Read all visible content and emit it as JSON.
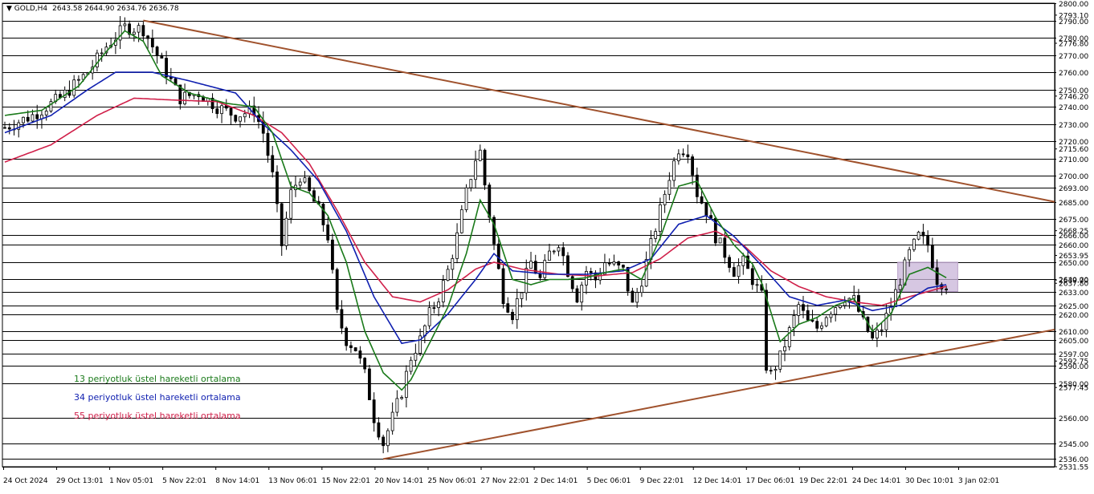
{
  "header": {
    "symbol": "GOLD,H4",
    "ohlc": "2643.58 2644.90 2634.76 2636.78"
  },
  "colors": {
    "ema13": "#1a7a1a",
    "ema34": "#1020b0",
    "ema55": "#d0204a",
    "trendline": "#a0522d",
    "candle": "#000000",
    "grid": "#000000",
    "highlight_box": "#c8b4d8"
  },
  "legend": [
    {
      "label": "13 periyotluk üstel hareketli ortalama",
      "color": "#1a7a1a"
    },
    {
      "label": "34 periyotluk üstel hareketli ortalama",
      "color": "#1020b0"
    },
    {
      "label": "55 periyotluk üstel hareketli ortalama",
      "color": "#d0204a"
    }
  ],
  "chart_data": {
    "type": "candlestick",
    "ylim": [
      2531.55,
      2800.0
    ],
    "y_levels": [
      2800.0,
      2790.0,
      2780.0,
      2770.0,
      2760.0,
      2750.0,
      2740.0,
      2730.0,
      2720.0,
      2710.0,
      2700.0,
      2693.0,
      2685.0,
      2675.0,
      2666.0,
      2660.0,
      2650.0,
      2640.0,
      2633.0,
      2625.0,
      2620.0,
      2610.0,
      2605.0,
      2597.0,
      2590.0,
      2580.0,
      2560.0,
      2545.0,
      2536.0
    ],
    "y_extra_ticks": [
      "2793.10",
      "2776.80",
      "2746.20",
      "2715.60",
      "2668.25",
      "2653.95",
      "2639.70",
      "2637.80",
      "2592.75",
      "2577.45",
      "2531.55"
    ],
    "x_tick_labels": [
      "24 Oct 2024",
      "29 Oct 13:01",
      "1 Nov 05:01",
      "5 Nov 22:01",
      "8 Nov 14:01",
      "13 Nov 06:01",
      "15 Nov 22:01",
      "20 Nov 14:01",
      "25 Nov 06:01",
      "27 Nov 22:01",
      "2 Dec 14:01",
      "5 Dec 06:01",
      "9 Dec 22:01",
      "12 Dec 14:01",
      "17 Dec 06:01",
      "19 Dec 22:01",
      "24 Dec 14:01",
      "30 Dec 10:01",
      "3 Jan 02:01"
    ],
    "price_path": [
      [
        0,
        2728
      ],
      [
        6,
        2735
      ],
      [
        12,
        2745
      ],
      [
        18,
        2760
      ],
      [
        22,
        2775
      ],
      [
        26,
        2786
      ],
      [
        30,
        2785
      ],
      [
        34,
        2765
      ],
      [
        38,
        2745
      ],
      [
        42,
        2748
      ],
      [
        46,
        2740
      ],
      [
        50,
        2735
      ],
      [
        54,
        2738
      ],
      [
        56,
        2725
      ],
      [
        58,
        2700
      ],
      [
        60,
        2660
      ],
      [
        62,
        2690
      ],
      [
        64,
        2700
      ],
      [
        66,
        2690
      ],
      [
        68,
        2680
      ],
      [
        70,
        2665
      ],
      [
        72,
        2620
      ],
      [
        74,
        2605
      ],
      [
        76,
        2600
      ],
      [
        78,
        2585
      ],
      [
        80,
        2560
      ],
      [
        82,
        2545
      ],
      [
        84,
        2560
      ],
      [
        86,
        2575
      ],
      [
        88,
        2595
      ],
      [
        90,
        2605
      ],
      [
        92,
        2620
      ],
      [
        94,
        2630
      ],
      [
        96,
        2645
      ],
      [
        98,
        2665
      ],
      [
        100,
        2690
      ],
      [
        102,
        2710
      ],
      [
        103,
        2714
      ],
      [
        104,
        2695
      ],
      [
        106,
        2660
      ],
      [
        108,
        2630
      ],
      [
        110,
        2620
      ],
      [
        112,
        2635
      ],
      [
        114,
        2650
      ],
      [
        116,
        2640
      ],
      [
        118,
        2655
      ],
      [
        120,
        2662
      ],
      [
        122,
        2645
      ],
      [
        124,
        2630
      ],
      [
        126,
        2645
      ],
      [
        128,
        2640
      ],
      [
        130,
        2650
      ],
      [
        132,
        2648
      ],
      [
        134,
        2645
      ],
      [
        136,
        2625
      ],
      [
        138,
        2640
      ],
      [
        140,
        2660
      ],
      [
        142,
        2680
      ],
      [
        144,
        2700
      ],
      [
        146,
        2716
      ],
      [
        148,
        2715
      ],
      [
        150,
        2690
      ],
      [
        152,
        2680
      ],
      [
        154,
        2665
      ],
      [
        156,
        2655
      ],
      [
        158,
        2645
      ],
      [
        160,
        2650
      ],
      [
        162,
        2640
      ],
      [
        164,
        2630
      ],
      [
        165,
        2590
      ],
      [
        166,
        2585
      ],
      [
        168,
        2595
      ],
      [
        170,
        2610
      ],
      [
        172,
        2625
      ],
      [
        174,
        2615
      ],
      [
        176,
        2612
      ],
      [
        178,
        2620
      ],
      [
        180,
        2625
      ],
      [
        182,
        2630
      ],
      [
        184,
        2628
      ],
      [
        186,
        2615
      ],
      [
        188,
        2605
      ],
      [
        190,
        2612
      ],
      [
        192,
        2625
      ],
      [
        194,
        2640
      ],
      [
        196,
        2655
      ],
      [
        198,
        2665
      ],
      [
        200,
        2660
      ],
      [
        202,
        2640
      ],
      [
        204,
        2637
      ]
    ],
    "ema13": [
      [
        0,
        2735
      ],
      [
        8,
        2738
      ],
      [
        16,
        2752
      ],
      [
        22,
        2772
      ],
      [
        26,
        2784
      ],
      [
        30,
        2778
      ],
      [
        34,
        2758
      ],
      [
        40,
        2748
      ],
      [
        48,
        2742
      ],
      [
        54,
        2740
      ],
      [
        58,
        2725
      ],
      [
        62,
        2694
      ],
      [
        66,
        2690
      ],
      [
        70,
        2677
      ],
      [
        74,
        2650
      ],
      [
        78,
        2610
      ],
      [
        82,
        2586
      ],
      [
        86,
        2576
      ],
      [
        88,
        2582
      ],
      [
        92,
        2603
      ],
      [
        96,
        2624
      ],
      [
        100,
        2655
      ],
      [
        103,
        2686
      ],
      [
        106,
        2672
      ],
      [
        110,
        2640
      ],
      [
        114,
        2637
      ],
      [
        118,
        2640
      ],
      [
        122,
        2640
      ],
      [
        126,
        2641
      ],
      [
        130,
        2644
      ],
      [
        134,
        2646
      ],
      [
        138,
        2640
      ],
      [
        142,
        2664
      ],
      [
        146,
        2694
      ],
      [
        150,
        2697
      ],
      [
        154,
        2676
      ],
      [
        158,
        2660
      ],
      [
        162,
        2649
      ],
      [
        164,
        2638
      ],
      [
        168,
        2604
      ],
      [
        172,
        2614
      ],
      [
        176,
        2618
      ],
      [
        180,
        2625
      ],
      [
        184,
        2629
      ],
      [
        188,
        2610
      ],
      [
        192,
        2620
      ],
      [
        196,
        2643
      ],
      [
        200,
        2647
      ],
      [
        204,
        2641
      ]
    ],
    "ema34": [
      [
        0,
        2725
      ],
      [
        10,
        2735
      ],
      [
        18,
        2750
      ],
      [
        24,
        2760
      ],
      [
        32,
        2760
      ],
      [
        40,
        2755
      ],
      [
        50,
        2748
      ],
      [
        56,
        2730
      ],
      [
        62,
        2715
      ],
      [
        68,
        2697
      ],
      [
        74,
        2668
      ],
      [
        80,
        2630
      ],
      [
        86,
        2603
      ],
      [
        90,
        2605
      ],
      [
        96,
        2620
      ],
      [
        102,
        2640
      ],
      [
        106,
        2655
      ],
      [
        110,
        2645
      ],
      [
        118,
        2643
      ],
      [
        126,
        2643
      ],
      [
        134,
        2645
      ],
      [
        140,
        2652
      ],
      [
        146,
        2672
      ],
      [
        152,
        2677
      ],
      [
        158,
        2665
      ],
      [
        164,
        2648
      ],
      [
        170,
        2630
      ],
      [
        176,
        2625
      ],
      [
        182,
        2628
      ],
      [
        188,
        2622
      ],
      [
        194,
        2625
      ],
      [
        200,
        2635
      ],
      [
        204,
        2637
      ]
    ],
    "ema55": [
      [
        0,
        2708
      ],
      [
        10,
        2718
      ],
      [
        20,
        2735
      ],
      [
        28,
        2745
      ],
      [
        36,
        2744
      ],
      [
        46,
        2743
      ],
      [
        54,
        2735
      ],
      [
        60,
        2725
      ],
      [
        66,
        2707
      ],
      [
        72,
        2680
      ],
      [
        78,
        2650
      ],
      [
        84,
        2630
      ],
      [
        90,
        2627
      ],
      [
        96,
        2634
      ],
      [
        102,
        2646
      ],
      [
        106,
        2650
      ],
      [
        112,
        2646
      ],
      [
        120,
        2643
      ],
      [
        128,
        2642
      ],
      [
        136,
        2644
      ],
      [
        142,
        2652
      ],
      [
        148,
        2664
      ],
      [
        154,
        2668
      ],
      [
        160,
        2660
      ],
      [
        166,
        2645
      ],
      [
        172,
        2636
      ],
      [
        178,
        2630
      ],
      [
        184,
        2627
      ],
      [
        190,
        2625
      ],
      [
        196,
        2630
      ],
      [
        204,
        2636
      ]
    ],
    "trendlines": [
      {
        "from": [
          30,
          2790
        ],
        "to": [
          228,
          2685
        ]
      },
      {
        "from": [
          82,
          2536
        ],
        "to": [
          228,
          2611
        ]
      }
    ],
    "highlight_box": {
      "x0": 194,
      "x1": 207,
      "y0": 2633,
      "y1": 2650
    }
  }
}
